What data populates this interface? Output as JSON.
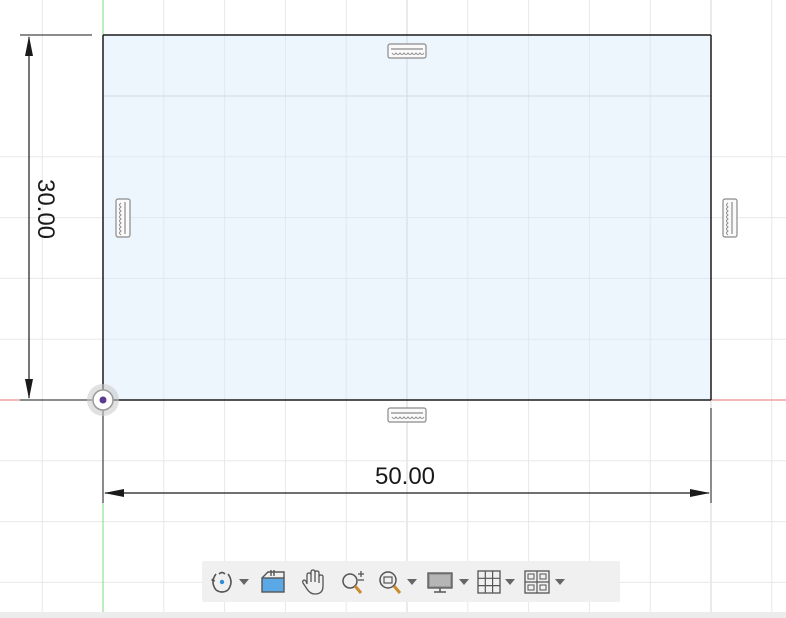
{
  "sketch": {
    "dimension_width": "50.00",
    "dimension_height": "30.00"
  },
  "colors": {
    "grid_minor": "#e8e8e8",
    "grid_major": "#d6d6d6",
    "x_axis": "#e57373",
    "y_axis": "#7ddc7d",
    "profile_fill": "#eef6fd",
    "sketch_line": "#1a1a1a"
  },
  "constraints": [
    "horizontal-constraint-icon",
    "vertical-constraint-icon",
    "vertical-constraint-icon",
    "horizontal-constraint-icon"
  ],
  "toolbar": {
    "items": [
      {
        "name": "orbit-icon",
        "has_dropdown": true
      },
      {
        "name": "look-at-icon",
        "has_dropdown": false
      },
      {
        "name": "pan-hand-icon",
        "has_dropdown": false
      },
      {
        "name": "zoom-icon",
        "has_dropdown": false
      },
      {
        "name": "fit-zoom-window-icon",
        "has_dropdown": true
      },
      {
        "name": "display-settings-icon",
        "has_dropdown": true
      },
      {
        "name": "grid-snap-icon",
        "has_dropdown": true
      },
      {
        "name": "viewports-icon",
        "has_dropdown": true
      }
    ]
  }
}
